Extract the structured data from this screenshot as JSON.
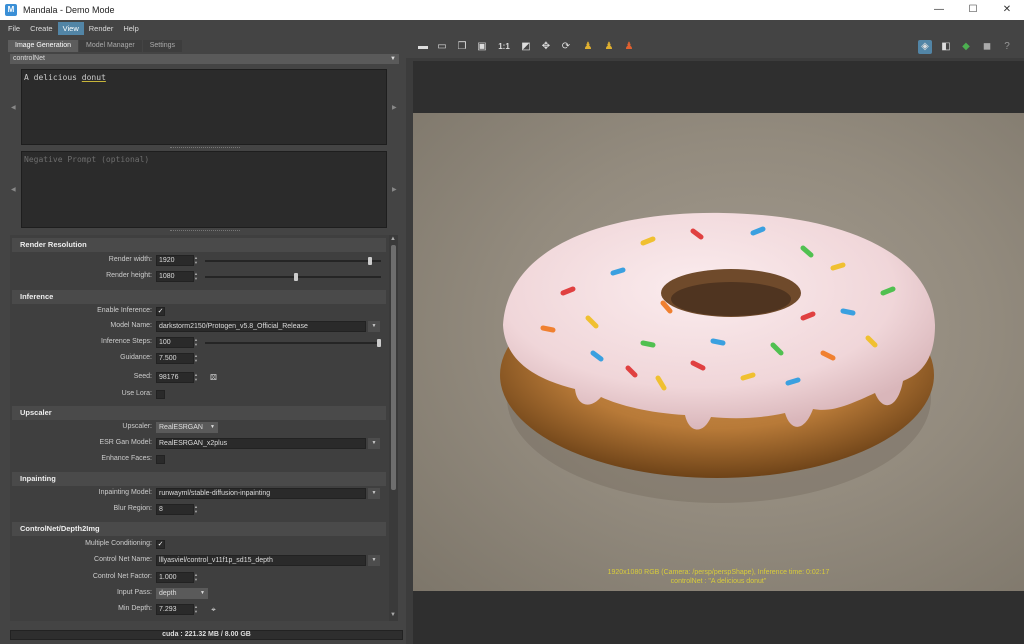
{
  "window": {
    "title": "Mandala - Demo Mode",
    "app_icon": "M",
    "min": "—",
    "max": "☐",
    "close": "✕"
  },
  "menu": [
    "File",
    "Create",
    "View",
    "Render",
    "Help"
  ],
  "tabs": [
    "Image Generation",
    "Model Manager",
    "Settings"
  ],
  "mode": "controlNet",
  "prompt": {
    "positive_lead": "A delicious ",
    "positive_word": "donut",
    "negative_placeholder": "Negative Prompt (optional)"
  },
  "sections": {
    "resolution": "Render Resolution",
    "inference": "Inference",
    "upscaler": "Upscaler",
    "inpainting": "Inpainting",
    "controlnet": "ControlNet/Depth2Img"
  },
  "fields": {
    "render_width": {
      "label": "Render width:",
      "value": "1920",
      "slider": 0.95
    },
    "render_height": {
      "label": "Render height:",
      "value": "1080",
      "slider": 0.52
    },
    "enable_inference": {
      "label": "Enable Inference:",
      "checked": "✓"
    },
    "model_name": {
      "label": "Model Name:",
      "value": "darkstorm2150/Protogen_v5.8_Official_Release"
    },
    "inference_steps": {
      "label": "Inference Steps:",
      "value": "100",
      "slider": 1.0
    },
    "guidance": {
      "label": "Guidance:",
      "value": "7.500"
    },
    "seed": {
      "label": "Seed:",
      "value": "98176"
    },
    "use_lora": {
      "label": "Use Lora:",
      "checked": ""
    },
    "upscaler": {
      "label": "Upscaler:",
      "value": "RealESRGAN"
    },
    "esr_gan_model": {
      "label": "ESR Gan Model:",
      "value": "RealESRGAN_x2plus"
    },
    "enhance_faces": {
      "label": "Enhance Faces:",
      "checked": ""
    },
    "inpainting_model": {
      "label": "Inpainting Model:",
      "value": "runwayml/stable-diffusion-inpainting"
    },
    "blur_region": {
      "label": "Blur Region:",
      "value": "8"
    },
    "multiple_conditioning": {
      "label": "Multiple Conditioning:",
      "checked": "✓"
    },
    "control_net_name": {
      "label": "Control Net Name:",
      "value": "lllyasviel/control_v11f1p_sd15_depth"
    },
    "control_net_factor": {
      "label": "Control Net Factor:",
      "value": "1.000"
    },
    "input_pass": {
      "label": "Input Pass:",
      "value": "depth"
    },
    "min_depth": {
      "label": "Min Depth:",
      "value": "7.293"
    }
  },
  "status": {
    "prefix": "cuda : ",
    "memory": "221.32 MB / 8.00 GB"
  },
  "toolbar": {
    "ratio": "1:1",
    "help": "?"
  },
  "render_info": {
    "line1": "1920x1080 RGB (Camera: /persp/perspShape), Inference time: 0:02:17",
    "line2": "controlNet : \"A delicious donut\""
  },
  "colors": {
    "accent": "#5285a6",
    "info_text": "#d8cc3a",
    "icing": "#f2dde0",
    "dough": "#b87a38"
  }
}
